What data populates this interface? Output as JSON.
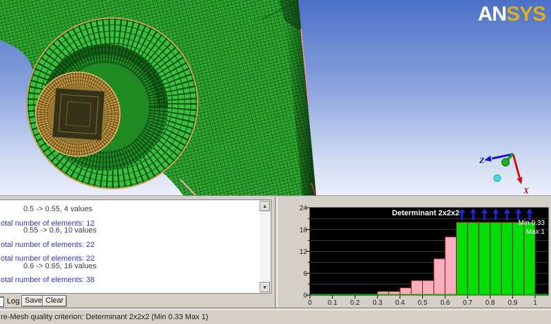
{
  "brand": {
    "part1": "AN",
    "part2": "SYS"
  },
  "viewport": {
    "triad": {
      "z_label": "Z",
      "x_label": "X"
    }
  },
  "log_panel": {
    "lines": [
      {
        "text": "0.5 -> 0.55, 4 values",
        "type": "detail",
        "gap_before": false
      },
      {
        "text": "otal number of elements: 12",
        "type": "total",
        "gap_before": true
      },
      {
        "text": "0.55 -> 0.6, 10 values",
        "type": "detail",
        "gap_before": false
      },
      {
        "text": "otal number of elements: 22",
        "type": "total",
        "gap_before": true
      },
      {
        "text": "otal number of elements: 22",
        "type": "total",
        "gap_before": true
      },
      {
        "text": "0.6 -> 0.65, 16 values",
        "type": "detail",
        "gap_before": false
      },
      {
        "text": "otal number of elements: 38",
        "type": "total",
        "gap_before": true
      }
    ],
    "log_checkbox_label": "Log",
    "save_button": "Save",
    "clear_button": "Clear",
    "scroll_up_glyph": "▲",
    "scroll_down_glyph": "▼"
  },
  "status_bar": {
    "text": "re-Mesh quality criterion: Determinant 2x2x2 (Min 0.33 Max 1)"
  },
  "chart_data": {
    "type": "bar",
    "title": "Determinant 2x2x2",
    "annotations": [
      "Min 0.33",
      "Max 1"
    ],
    "xlabel": "",
    "ylabel": "",
    "xlim": [
      0,
      1
    ],
    "ylim": [
      0,
      24
    ],
    "x_tick_labels": [
      "0",
      "0.1",
      "0.2",
      "0.3",
      "0.4",
      "0.5",
      "0.6",
      "0.7",
      "0.8",
      "0.9",
      "1"
    ],
    "y_major_ticks": [
      0,
      6,
      12,
      18,
      24
    ],
    "y_minor_ticks": [
      3,
      9,
      15,
      21
    ],
    "grid": true,
    "bin_width": 0.05,
    "bins": [
      {
        "x0": 0.3,
        "count": 1,
        "color": "pink"
      },
      {
        "x0": 0.35,
        "count": 1,
        "color": "pink"
      },
      {
        "x0": 0.4,
        "count": 2,
        "color": "pink"
      },
      {
        "x0": 0.45,
        "count": 4,
        "color": "pink"
      },
      {
        "x0": 0.5,
        "count": 4,
        "color": "pink"
      },
      {
        "x0": 0.55,
        "count": 10,
        "color": "pink"
      },
      {
        "x0": 0.6,
        "count": 16,
        "color": "pink"
      },
      {
        "x0": 0.65,
        "count": 20,
        "color": "green"
      },
      {
        "x0": 0.7,
        "count": 20,
        "color": "green"
      },
      {
        "x0": 0.75,
        "count": 20,
        "color": "green"
      },
      {
        "x0": 0.8,
        "count": 20,
        "color": "green"
      },
      {
        "x0": 0.85,
        "count": 20,
        "color": "green"
      },
      {
        "x0": 0.9,
        "count": 20,
        "color": "green"
      },
      {
        "x0": 0.95,
        "count": 20,
        "color": "green"
      }
    ],
    "arrows_over_green_bins": true,
    "colors": {
      "pink": "#f7afc0",
      "green": "#00dd08",
      "bar_outline": "#8b1a1a",
      "plot_background": "#000000",
      "grid_line": "#3c3c3c",
      "arrow": "#2424e6",
      "baseline": "#00b400",
      "text": "#ffffff",
      "axis_text": "#1a1a1a"
    }
  }
}
